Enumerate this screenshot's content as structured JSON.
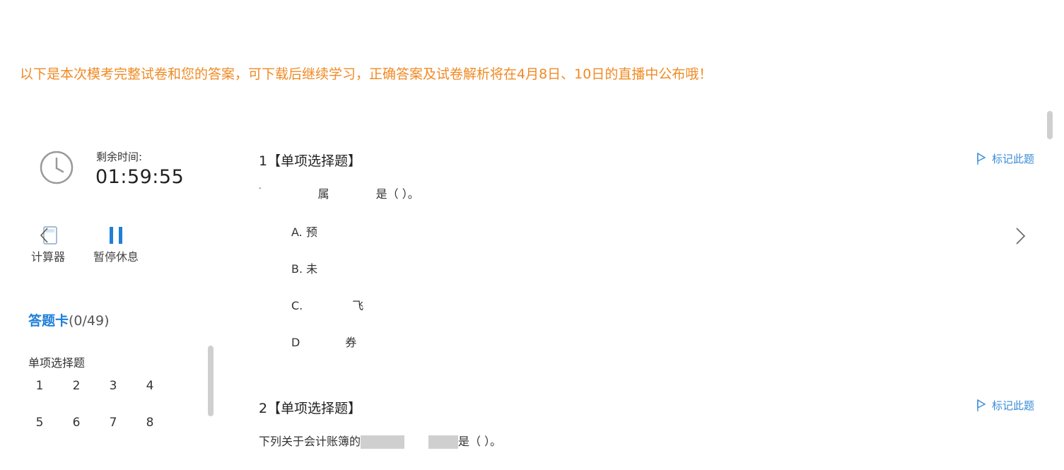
{
  "banner": {
    "notice": "以下是本次模考完整试卷和您的答案，可下载后继续学习，正确答案及试卷解析将在4月8日、10日的直播中公布哦！"
  },
  "timer": {
    "label": "剩余时间:",
    "value": "01:59:55"
  },
  "tools": {
    "calculator_label": "计算器",
    "pause_label": "暂停休息"
  },
  "answer_card": {
    "title": "答题卡",
    "count": "(0/49)",
    "section_label": "单项选择题",
    "numbers": [
      "1",
      "2",
      "3",
      "4",
      "5",
      "6",
      "7",
      "8"
    ]
  },
  "questions": [
    {
      "header": "1【单项选择题】",
      "mark_label": "标记此题",
      "stem_start": "-",
      "stem_mid": "属",
      "stem_end": "是（  ）。",
      "options": [
        {
          "letter": "A.",
          "text": "预"
        },
        {
          "letter": "B.",
          "text": "未"
        },
        {
          "letter": "C.",
          "text": "飞"
        },
        {
          "letter": "D",
          "text": "券"
        }
      ]
    },
    {
      "header": "2【单项选择题】",
      "mark_label": "标记此题",
      "stem_start": "下列关于会计账簿的",
      "stem_end": "是（  ）。"
    }
  ],
  "colors": {
    "banner": "#f08a24",
    "accent_blue": "#1f7fd8",
    "mark_blue": "#3a8dd8"
  }
}
